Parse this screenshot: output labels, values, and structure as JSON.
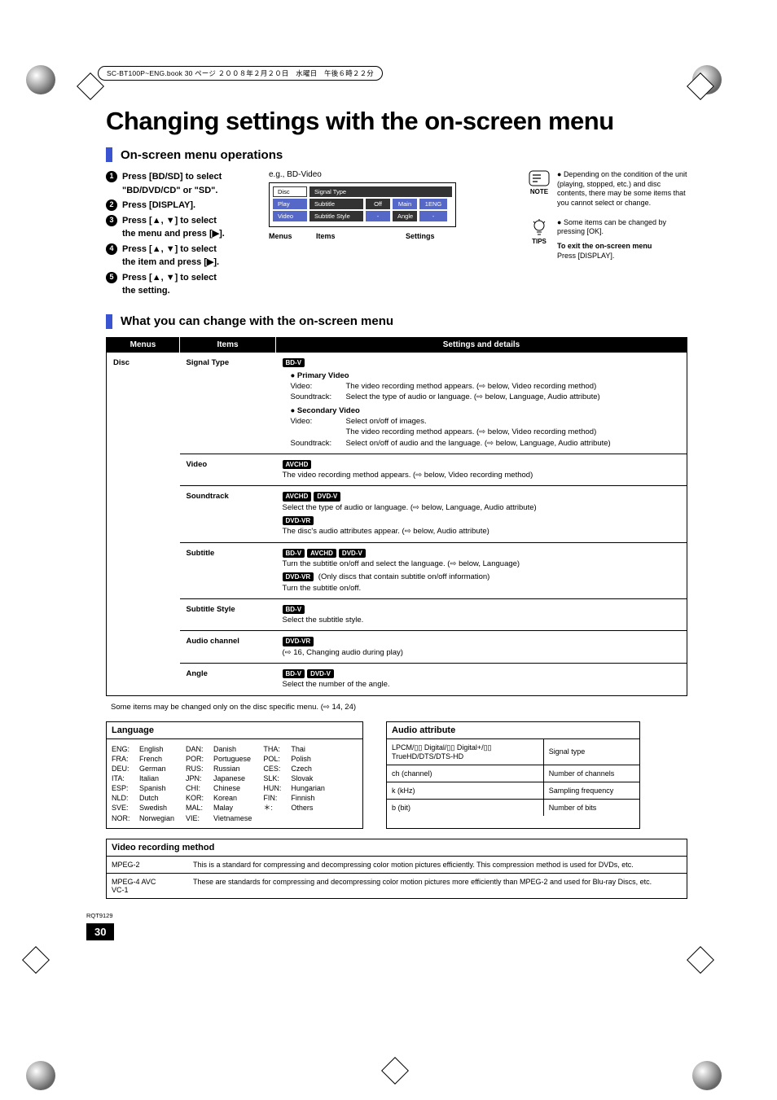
{
  "meta": {
    "book_line": "SC-BT100P~ENG.book  30 ページ  ２００８年２月２０日　水曜日　午後６時２２分"
  },
  "title": "Changing settings with the on-screen menu",
  "section1": "On-screen menu operations",
  "steps": {
    "s1": "Press [BD/SD] to select \"BD/DVD/CD\" or \"SD\".",
    "s2": "Press [DISPLAY].",
    "s3a": "Press [▲, ▼] to select",
    "s3b": "the menu and press [▶].",
    "s4a": "Press [▲, ▼] to select",
    "s4b": "the item and press [▶].",
    "s5a": "Press [▲, ▼] to select",
    "s5b": "the setting."
  },
  "diagram": {
    "eg": "e.g., BD-Video",
    "left": {
      "disc": "Disc",
      "play": "Play",
      "video": "Video"
    },
    "right": {
      "signal_type": "Signal Type",
      "subtitle": "Subtitle",
      "subtitle_style": "Subtitle Style",
      "off": "Off",
      "main": "Main",
      "one_eng": "1ENG",
      "dash": "-",
      "angle": "Angle",
      "dash2": "-"
    },
    "labels": {
      "menus": "Menus",
      "items": "Items",
      "settings": "Settings"
    }
  },
  "notes": {
    "note_label": "NOTE",
    "tips_label": "TIPS",
    "note_text": "Depending on the condition of the unit (playing, stopped, etc.) and disc contents, there may be some items that you cannot select or change.",
    "tip_text": "Some items can be changed by pressing [OK].",
    "exit_bold": "To exit the on-screen menu",
    "exit_text": "Press [DISPLAY]."
  },
  "section2": "What you can change with the on-screen menu",
  "table": {
    "hdr_menus": "Menus",
    "hdr_items": "Items",
    "hdr_settings": "Settings and details",
    "menu_disc": "Disc",
    "signal": {
      "item": "Signal Type",
      "badge": "BD-V",
      "pv": "Primary Video",
      "sv": "Secondary Video",
      "video_lbl": "Video:",
      "soundtrack_lbl": "Soundtrack:",
      "pv_video": "The video recording method appears. (⇨ below, Video recording method)",
      "pv_sound": "Select the type of audio or language. (⇨ below, Language, Audio attribute)",
      "sv_video1": "Select on/off of images.",
      "sv_video2": "The video recording method appears. (⇨ below, Video recording method)",
      "sv_sound": "Select on/off of audio and the language. (⇨ below, Language, Audio attribute)"
    },
    "video": {
      "item": "Video",
      "badge": "AVCHD",
      "text": "The video recording method appears. (⇨ below, Video recording method)"
    },
    "soundtrack": {
      "item": "Soundtrack",
      "b1": "AVCHD",
      "b2": "DVD-V",
      "t1": "Select the type of audio or language. (⇨ below, Language, Audio attribute)",
      "b3": "DVD-VR",
      "t2": "The disc's audio attributes appear. (⇨ below, Audio attribute)"
    },
    "subtitle": {
      "item": "Subtitle",
      "b1": "BD-V",
      "b2": "AVCHD",
      "b3": "DVD-V",
      "t1": "Turn the subtitle on/off and select the language. (⇨ below, Language)",
      "b4": "DVD-VR",
      "t2a": " (Only discs that contain subtitle on/off information)",
      "t2b": "Turn the subtitle on/off."
    },
    "sub_style": {
      "item": "Subtitle Style",
      "b1": "BD-V",
      "t1": "Select the subtitle style."
    },
    "audio_ch": {
      "item": "Audio channel",
      "b1": "DVD-VR",
      "t1": "(⇨ 16, Changing audio during play)"
    },
    "angle": {
      "item": "Angle",
      "b1": "BD-V",
      "b2": "DVD-V",
      "t1": "Select the number of the angle."
    }
  },
  "footnote": "Some items may be changed only on the disc specific menu. (⇨ 14, 24)",
  "language": {
    "title": "Language",
    "rows": [
      [
        "ENG:",
        "English",
        "DAN:",
        "Danish",
        "THA:",
        "Thai"
      ],
      [
        "FRA:",
        "French",
        "POR:",
        "Portuguese",
        "POL:",
        "Polish"
      ],
      [
        "DEU:",
        "German",
        "RUS:",
        "Russian",
        "CES:",
        "Czech"
      ],
      [
        "ITA:",
        "Italian",
        "JPN:",
        "Japanese",
        "SLK:",
        "Slovak"
      ],
      [
        "ESP:",
        "Spanish",
        "CHI:",
        "Chinese",
        "HUN:",
        "Hungarian"
      ],
      [
        "NLD:",
        "Dutch",
        "KOR:",
        "Korean",
        "FIN:",
        "Finnish"
      ],
      [
        "SVE:",
        "Swedish",
        "MAL:",
        "Malay",
        "＊:",
        "Others"
      ],
      [
        "NOR:",
        "Norwegian",
        "VIE:",
        "Vietnamese",
        "",
        ""
      ]
    ]
  },
  "audio": {
    "title": "Audio attribute",
    "rows": [
      [
        "LPCM/▯▯ Digital/▯▯ Digital+/▯▯ TrueHD/DTS/DTS-HD",
        "Signal type"
      ],
      [
        "ch (channel)",
        "Number of channels"
      ],
      [
        "k (kHz)",
        "Sampling frequency"
      ],
      [
        "b (bit)",
        "Number of bits"
      ]
    ]
  },
  "video_rec": {
    "title": "Video recording method",
    "rows": [
      [
        "MPEG-2",
        "This is a standard for compressing and decompressing color motion pictures efficiently. This compression method is used for DVDs, etc."
      ],
      [
        "MPEG-4 AVC\nVC-1",
        "These are standards for compressing and decompressing color motion pictures more efficiently than MPEG-2 and used for Blu-ray Discs, etc."
      ]
    ]
  },
  "pagecode": "RQT9129",
  "pagenum": "30"
}
